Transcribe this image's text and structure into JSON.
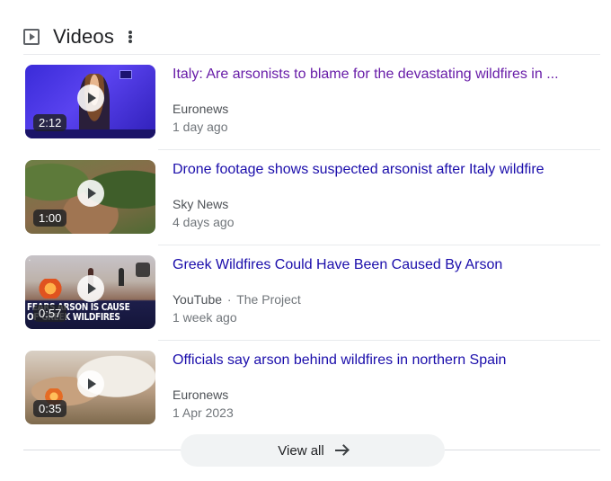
{
  "section": {
    "title": "Videos",
    "icon": "video-play-icon"
  },
  "videos": [
    {
      "title": "Italy: Are arsonists to blame for the devastating wildfires in ...",
      "source": "Euronews",
      "channel": "",
      "age": "1 day ago",
      "duration": "2:12",
      "visited": true
    },
    {
      "title": "Drone footage shows suspected arsonist after Italy wildfire",
      "source": "Sky News",
      "channel": "",
      "age": "4 days ago",
      "duration": "1:00",
      "visited": false
    },
    {
      "title": "Greek Wildfires Could Have Been Caused By Arson",
      "source": "YouTube",
      "separator": "·",
      "channel": "The Project",
      "age": "1 week ago",
      "duration": "0:57",
      "visited": false,
      "thumb_text": "FEARS ARSON IS CAUSE\nOF GREEK WILDFIRES"
    },
    {
      "title": "Officials say arson behind wildfires in northern Spain",
      "source": "Euronews",
      "channel": "",
      "age": "1 Apr 2023",
      "duration": "0:35",
      "visited": false
    }
  ],
  "view_all": {
    "label": "View all"
  },
  "colors": {
    "link": "#1a0dab",
    "visited_link": "#681da8",
    "meta": "#70757a"
  }
}
